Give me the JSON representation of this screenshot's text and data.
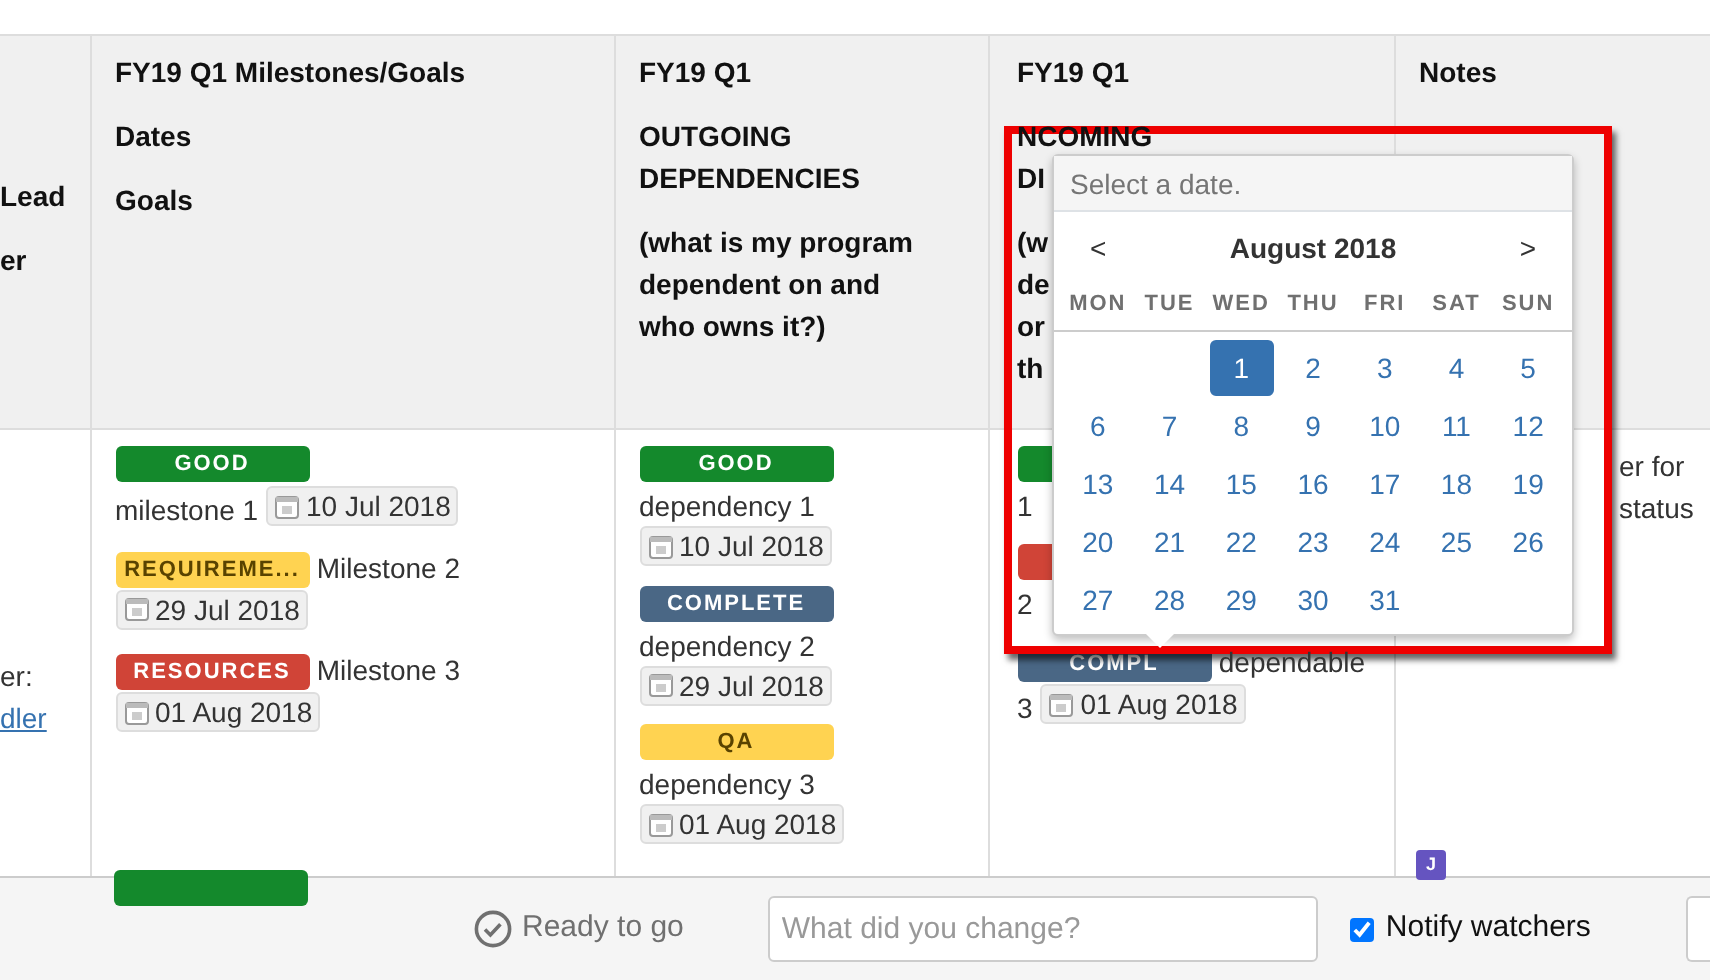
{
  "header": [
    {
      "paragraphs": [
        [
          "Lead"
        ],
        [
          "er"
        ]
      ]
    },
    {
      "title": "FY19 Q1 Milestones/Goals",
      "paragraphs": [
        [
          "Dates"
        ],
        [
          "Goals"
        ]
      ]
    },
    {
      "title": "FY19 Q1",
      "paragraphs": [
        [
          "OUTGOING",
          "DEPENDENCIES"
        ],
        [
          "(what is my program",
          "dependent on and",
          "who owns it?)"
        ]
      ]
    },
    {
      "title": "FY19 Q1",
      "paragraphs": [
        [
          "NCOMING",
          "DI"
        ],
        [
          "(w",
          "de",
          "or",
          "th"
        ]
      ]
    },
    {
      "title": "Notes"
    }
  ],
  "row": {
    "owner": [
      {
        "kind": "text",
        "text": "er:"
      },
      {
        "kind": "link",
        "text": "dler"
      }
    ],
    "milestones": [
      {
        "stacked": true,
        "kind": "good",
        "status": "GOOD",
        "text": "milestone 1",
        "date": "10 Jul 2018"
      },
      {
        "stacked": false,
        "kind": "requirements",
        "status": "REQUIREME...",
        "text": "Milestone 2",
        "date": "29 Jul 2018"
      },
      {
        "stacked": false,
        "kind": "resources",
        "status": "RESOURCES",
        "text": "Milestone 3",
        "date": "01 Aug 2018"
      }
    ],
    "outgoing": [
      {
        "stacked": true,
        "kind": "good",
        "status": "GOOD",
        "text": "dependency 1",
        "date": "10 Jul 2018"
      },
      {
        "stacked": true,
        "kind": "complete",
        "status": "COMPLETE",
        "text": "dependency 2",
        "date": "29 Jul 2018"
      },
      {
        "stacked": true,
        "kind": "qa",
        "status": "QA",
        "text": "dependency 3",
        "date": "01 Aug 2018"
      }
    ],
    "incoming": [
      {
        "stacked": true,
        "kind": "good",
        "text": "1"
      },
      {
        "stacked": true,
        "kind": "resources",
        "text": "2"
      },
      {
        "stacked": false,
        "kind": "complete",
        "status": "COMPL",
        "text": "dependable",
        "index": "3",
        "date": "01 Aug 2018"
      }
    ],
    "notes": [
      "er for",
      "status"
    ]
  },
  "next_row": {
    "badge": {
      "kind": "good"
    },
    "avatar": "J"
  },
  "date_picker": {
    "placeholder": "Select a date.",
    "prev": "<",
    "month": "August 2018",
    "next": ">",
    "weekdays": [
      "MON",
      "TUE",
      "WED",
      "THU",
      "FRI",
      "SAT",
      "SUN"
    ],
    "weeks": [
      [
        {
          "kind": "empty"
        },
        {
          "kind": "empty"
        },
        {
          "kind": "day",
          "day": "1",
          "selected": true
        },
        {
          "kind": "day",
          "day": "2",
          "selected": false
        },
        {
          "kind": "day",
          "day": "3",
          "selected": false
        },
        {
          "kind": "day",
          "day": "4",
          "selected": false
        },
        {
          "kind": "day",
          "day": "5",
          "selected": false
        }
      ],
      [
        {
          "kind": "day",
          "day": "6",
          "selected": false
        },
        {
          "kind": "day",
          "day": "7",
          "selected": false
        },
        {
          "kind": "day",
          "day": "8",
          "selected": false
        },
        {
          "kind": "day",
          "day": "9",
          "selected": false
        },
        {
          "kind": "day",
          "day": "10",
          "selected": false
        },
        {
          "kind": "day",
          "day": "11",
          "selected": false
        },
        {
          "kind": "day",
          "day": "12",
          "selected": false
        }
      ],
      [
        {
          "kind": "day",
          "day": "13",
          "selected": false
        },
        {
          "kind": "day",
          "day": "14",
          "selected": false
        },
        {
          "kind": "day",
          "day": "15",
          "selected": false
        },
        {
          "kind": "day",
          "day": "16",
          "selected": false
        },
        {
          "kind": "day",
          "day": "17",
          "selected": false
        },
        {
          "kind": "day",
          "day": "18",
          "selected": false
        },
        {
          "kind": "day",
          "day": "19",
          "selected": false
        }
      ],
      [
        {
          "kind": "day",
          "day": "20",
          "selected": false
        },
        {
          "kind": "day",
          "day": "21",
          "selected": false
        },
        {
          "kind": "day",
          "day": "22",
          "selected": false
        },
        {
          "kind": "day",
          "day": "23",
          "selected": false
        },
        {
          "kind": "day",
          "day": "24",
          "selected": false
        },
        {
          "kind": "day",
          "day": "25",
          "selected": false
        },
        {
          "kind": "day",
          "day": "26",
          "selected": false
        }
      ],
      [
        {
          "kind": "day",
          "day": "27",
          "selected": false
        },
        {
          "kind": "day",
          "day": "28",
          "selected": false
        },
        {
          "kind": "day",
          "day": "29",
          "selected": false
        },
        {
          "kind": "day",
          "day": "30",
          "selected": false
        },
        {
          "kind": "day",
          "day": "31",
          "selected": false
        }
      ]
    ]
  },
  "highlight_frame": true,
  "footer": {
    "status": "Ready to go",
    "comment_placeholder": "What did you change?",
    "notify": {
      "label": "Notify watchers",
      "checked": true
    }
  }
}
